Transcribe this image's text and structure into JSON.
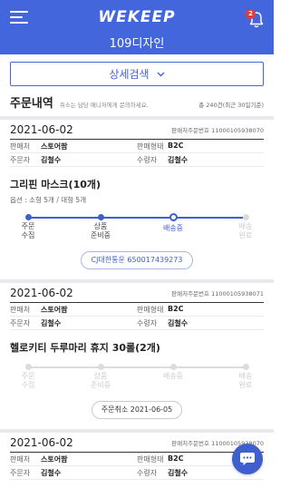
{
  "header": {
    "logo": "WEKEEP",
    "brand_name": "109디자인",
    "notification_count": "2"
  },
  "filter": {
    "label": "상세검색"
  },
  "orders_header": {
    "title": "주문내역",
    "note": "취소는 담당 매니저에게 문의하세요.",
    "total": "총 240건(최근 30일기준)"
  },
  "labels": {
    "order_no": "판매처주문번호",
    "seller": "판매처",
    "sale_type": "판매형태",
    "orderer": "주문자",
    "receiver": "수령자"
  },
  "steps": [
    {
      "line1": "주문",
      "line2": "수집"
    },
    {
      "line1": "상품",
      "line2": "준비중"
    },
    {
      "line1": "배송중",
      "line2": ""
    },
    {
      "line1": "배송",
      "line2": "완료"
    }
  ],
  "orders": [
    {
      "date": "2021-06-02",
      "order_no": "11000105938070",
      "seller": "스토어팜",
      "sale_type": "B2C",
      "orderer": "김철수",
      "receiver": "김철수",
      "product": "그리핀 마스크(10개)",
      "option": "옵션 : 소형 5개 / 대형 5개",
      "progress_step": 3,
      "action": "CJ대한통운 650017439273"
    },
    {
      "date": "2021-06-02",
      "order_no": "11000105938071",
      "seller": "스토어팜",
      "sale_type": "B2C",
      "orderer": "김철수",
      "receiver": "김철수",
      "product": "헬로키티 두루마리 휴지 30롤(2개)",
      "progress_step": 0,
      "action": "주문취소 2021-06-05"
    },
    {
      "date": "2021-06-02",
      "order_no": "11000105938070",
      "seller": "스토어팜",
      "sale_type": "B2C",
      "orderer": "김철수",
      "receiver": "김철수"
    }
  ],
  "colors": {
    "primary": "#4466dd",
    "badge": "#e23b3b"
  },
  "icons": {
    "menu": "hamburger-icon",
    "notification": "bell-icon",
    "filter": "chevron-down-icon",
    "chat": "chat-bubble-icon"
  }
}
